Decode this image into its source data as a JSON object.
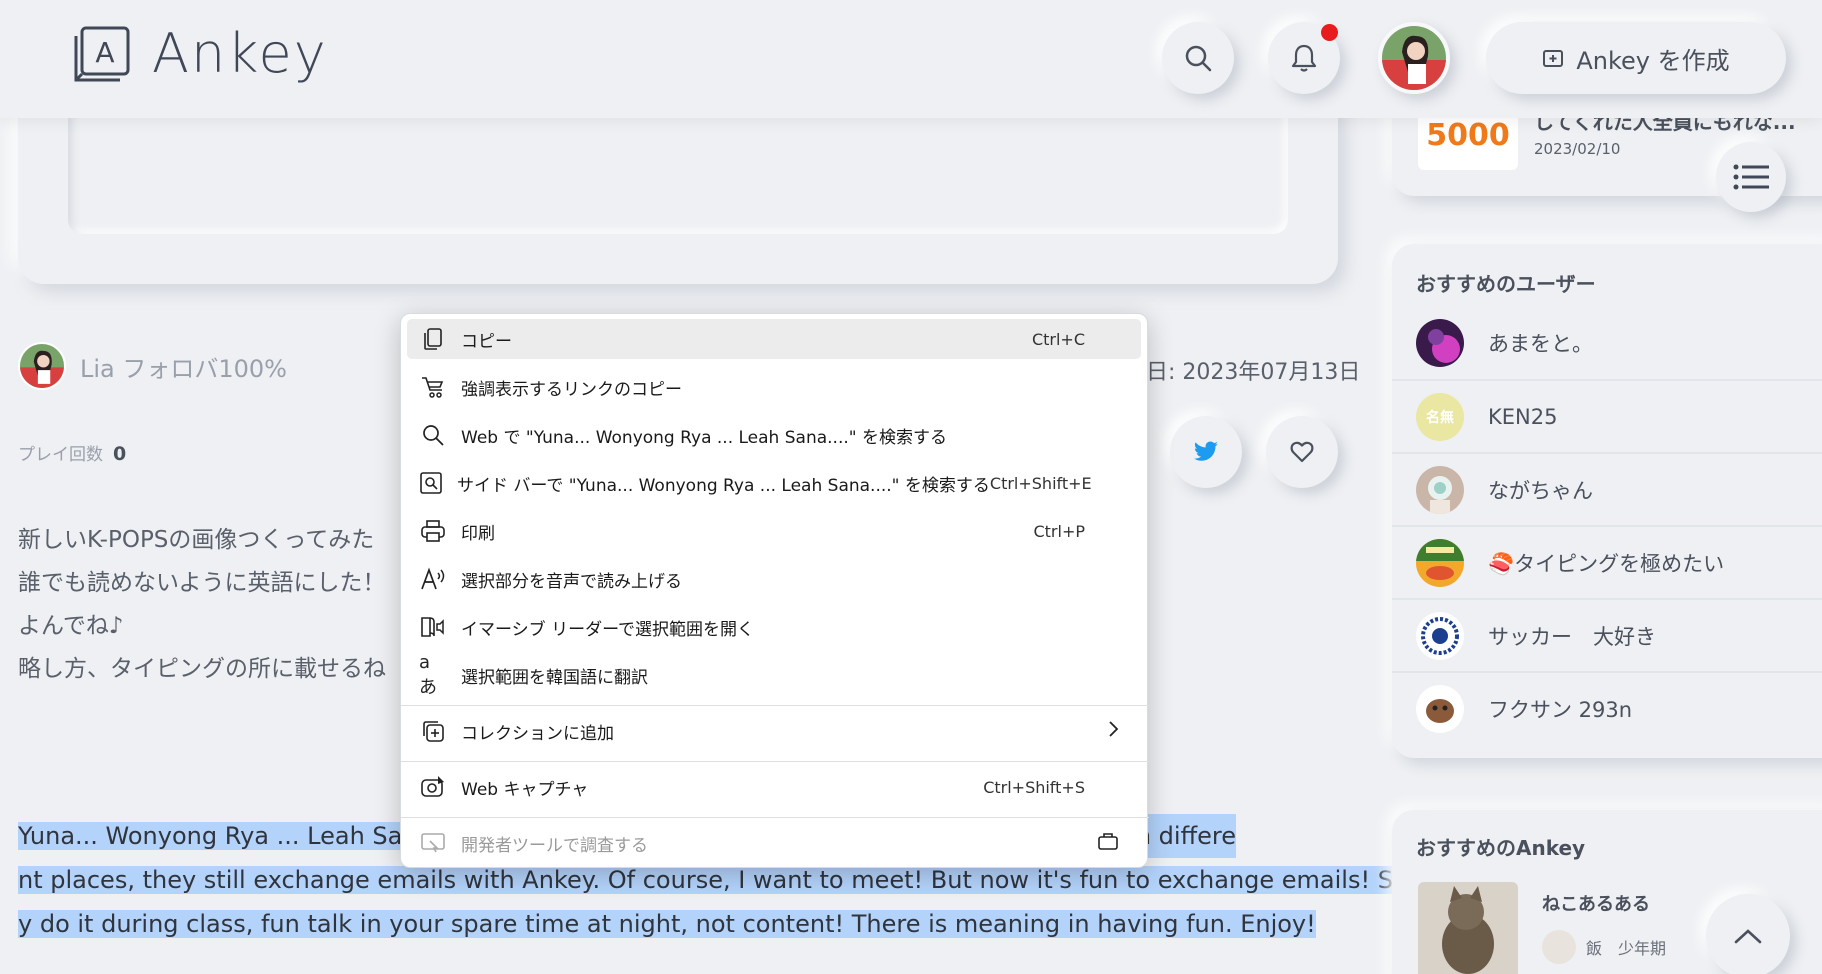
{
  "header": {
    "logo_text": "Ankey",
    "create_label": "Ankey を作成"
  },
  "post": {
    "author": "Lia フォロバ100%",
    "date": "日: 2023年07月13日",
    "play_label": "プレイ回数",
    "play_count": "0",
    "description": [
      "新しいK-POPSの画像つくってみた",
      "誰でも読めないように英語にした！",
      "よんでね♪",
      "略し方、タイピングの所に載せるね"
    ],
    "selected_lines": [
      "Yuna... Wonyong Rya ... Leah Sana....",
      "they live in differe",
      "nt places, they still exchange emails with Ankey. Of course, I want to meet! But now it's fun to exchange emails! Secretl",
      "y do it during class, fun talk in your spare time at night, not content! There is meaning in having fun. Enjoy!"
    ]
  },
  "sidebar": {
    "top_item": {
      "title": "してくれた人全員にもれな...",
      "date": "2023/02/10",
      "badge": "5000"
    },
    "users_title": "おすすめのユーザー",
    "users": [
      {
        "name": "あまをと。"
      },
      {
        "name": "KEN25",
        "avatar_text": "名無"
      },
      {
        "name": "ながちゃん"
      },
      {
        "name": "🍣タイピングを極めたい"
      },
      {
        "name": "サッカー　大好き"
      },
      {
        "name": "フクサン 293n"
      }
    ],
    "ankey_title": "おすすめのAnkey",
    "ankey_item": {
      "title": "ねこあるある",
      "author": "飯　少年期"
    }
  },
  "context_menu": {
    "items": [
      {
        "label": "コピー",
        "shortcut": "Ctrl+C",
        "icon": "copy-icon"
      },
      {
        "label": "強調表示するリンクのコピー",
        "shortcut": "",
        "icon": "link-copy-icon"
      },
      {
        "label": "Web で \"Yuna... Wonyong Rya ... Leah Sana....\" を検索する",
        "shortcut": "",
        "icon": "search-icon"
      },
      {
        "label": "サイド バーで \"Yuna... Wonyong Rya ... Leah Sana....\" を検索する",
        "shortcut": "Ctrl+Shift+E",
        "icon": "sidebar-search-icon"
      },
      {
        "label": "印刷",
        "shortcut": "Ctrl+P",
        "icon": "print-icon"
      },
      {
        "label": "選択部分を音声で読み上げる",
        "shortcut": "",
        "icon": "read-aloud-icon"
      },
      {
        "label": "イマーシブ リーダーで選択範囲を開く",
        "shortcut": "",
        "icon": "immersive-reader-icon"
      },
      {
        "label": "選択範囲を韓国語に翻訳",
        "shortcut": "",
        "icon": "translate-icon"
      },
      {
        "label": "コレクションに追加",
        "shortcut": "",
        "icon": "collections-icon"
      },
      {
        "label": "Web キャプチャ",
        "shortcut": "Ctrl+Shift+S",
        "icon": "web-capture-icon"
      },
      {
        "label": "開発者ツールで調査する",
        "shortcut": "",
        "icon": "devtools-icon"
      }
    ]
  },
  "colors": {
    "background": "#eef0f3",
    "selection": "#b3d3fb",
    "notification": "#e81c1c",
    "twitter": "#1d9bf0"
  }
}
